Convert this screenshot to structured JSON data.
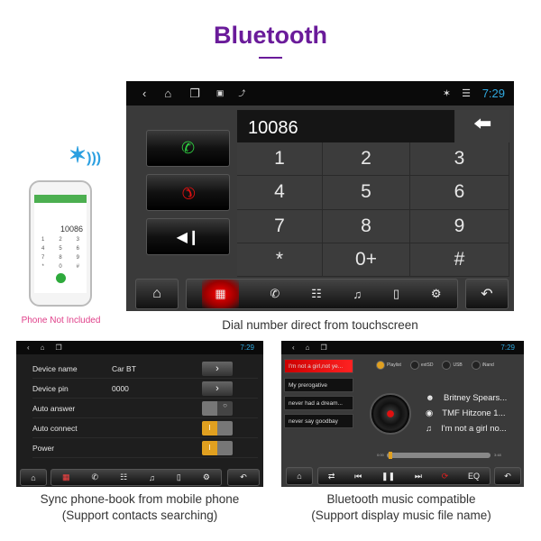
{
  "header": {
    "title": "Bluetooth",
    "accent": "#6a1b9a"
  },
  "phone": {
    "note": "Phone Not Included",
    "number": "10086",
    "keys": [
      "1",
      "2",
      "3",
      "4",
      "5",
      "6",
      "7",
      "8",
      "9",
      "*",
      "0",
      "#"
    ]
  },
  "status": {
    "time": "7:29"
  },
  "dialer": {
    "number": "10086",
    "keys": [
      "1",
      "2",
      "3",
      "4",
      "5",
      "6",
      "7",
      "8",
      "9",
      "*",
      "0+",
      "#"
    ],
    "caption": "Dial number direct from touchscreen"
  },
  "settings": {
    "rows": [
      {
        "label": "Device name",
        "value": "Car BT",
        "control": "arrow"
      },
      {
        "label": "Device pin",
        "value": "0000",
        "control": "arrow"
      },
      {
        "label": "Auto answer",
        "value": "",
        "control": "toggle",
        "on": false
      },
      {
        "label": "Auto connect",
        "value": "",
        "control": "toggle",
        "on": true
      },
      {
        "label": "Power",
        "value": "",
        "control": "toggle",
        "on": true
      }
    ],
    "caption1": "Sync phone-book from mobile phone",
    "caption2": "(Support contacts searching)"
  },
  "music": {
    "playlist": [
      "I'm not a girl,not ye...",
      "My prerogative",
      "never had a dream...",
      "never say goodbay"
    ],
    "sources": [
      "Playlist",
      "extSD",
      "USB",
      "iNand"
    ],
    "artist": "Britney Spears...",
    "album": "TMF Hitzone 1...",
    "track": "I'm not a girl no...",
    "elapsed": "0:00",
    "duration": "3:48",
    "progress": 0.02,
    "eq_label": "EQ",
    "caption1": "Bluetooth music compatible",
    "caption2": "(Support display music file name)"
  }
}
